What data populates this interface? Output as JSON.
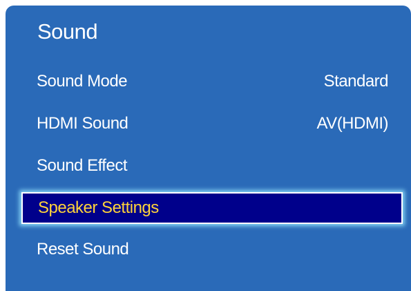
{
  "panel": {
    "title": "Sound"
  },
  "menu": {
    "items": [
      {
        "label": "Sound Mode",
        "value": "Standard"
      },
      {
        "label": "HDMI Sound",
        "value": "AV(HDMI)"
      },
      {
        "label": "Sound Effect",
        "value": ""
      },
      {
        "label": "Speaker Settings",
        "value": ""
      },
      {
        "label": "Reset Sound",
        "value": ""
      }
    ],
    "selected_index": 3
  },
  "colors": {
    "panel_background": "#2a6ab8",
    "selected_background": "#00008b",
    "selected_text": "#ffd33a",
    "selected_glow": "#96e6ff",
    "text": "#ffffff"
  }
}
